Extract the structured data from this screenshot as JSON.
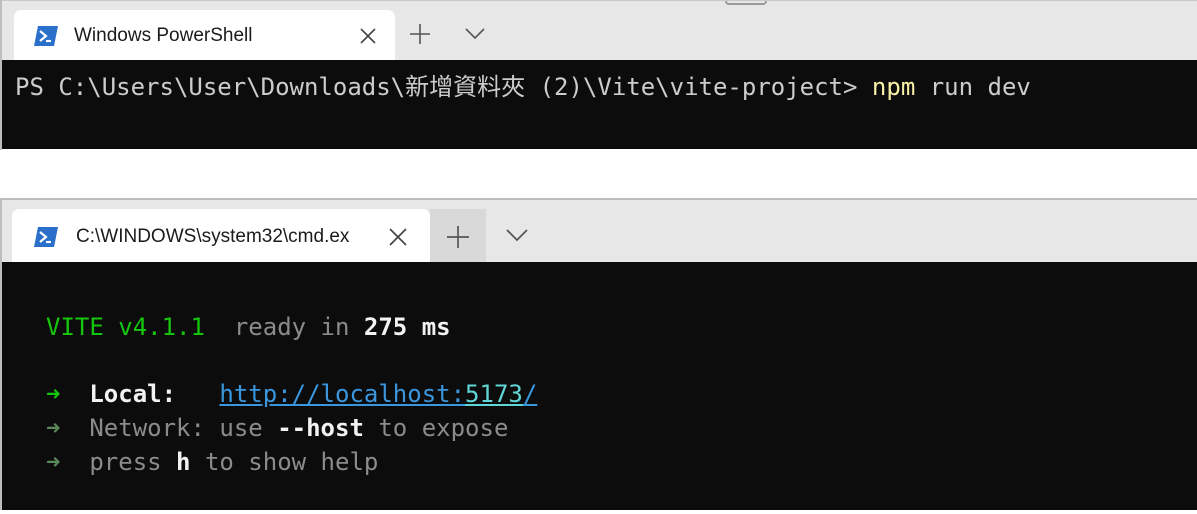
{
  "windows": [
    {
      "tab": {
        "title": "Windows PowerShell",
        "icon": "powershell-icon",
        "close_icon": "close-icon"
      },
      "new_tab_icon": "plus-icon",
      "dropdown_icon": "chevron-down-icon",
      "terminal": {
        "prompt": "PS C:\\Users\\User\\Downloads\\新增資料夾 (2)\\Vite\\vite-project> ",
        "command": "npm",
        "args": " run dev"
      }
    },
    {
      "tab": {
        "title": "C:\\WINDOWS\\system32\\cmd.ex",
        "icon": "powershell-icon",
        "close_icon": "close-icon"
      },
      "new_tab_icon": "plus-icon",
      "dropdown_icon": "chevron-down-icon",
      "terminal": {
        "vite_name": "VITE",
        "vite_version": " v4.1.1",
        "ready_text": "  ready in ",
        "ready_time": "275",
        "ready_unit": " ms",
        "arrow": "➜",
        "local_label": "  Local:",
        "local_url_base": "http://localhost:",
        "local_url_port": "5173",
        "local_url_slash": "/",
        "network_label": "  Network: ",
        "network_use": "use ",
        "network_flag": "--host",
        "network_tail": " to expose",
        "press_text": "  press ",
        "press_key": "h",
        "press_tail": " to show help"
      }
    }
  ],
  "colors": {
    "terminal_bg": "#0c0c0c",
    "tabbar_bg": "#e7e7e7",
    "tab_active_bg": "#ffffff",
    "vite_green": "#16c60c",
    "command_yellow": "#f9f1a5",
    "link_blue": "#3a96dd",
    "link_cyan": "#61d6d6",
    "dim_text": "#8b8b8b"
  }
}
